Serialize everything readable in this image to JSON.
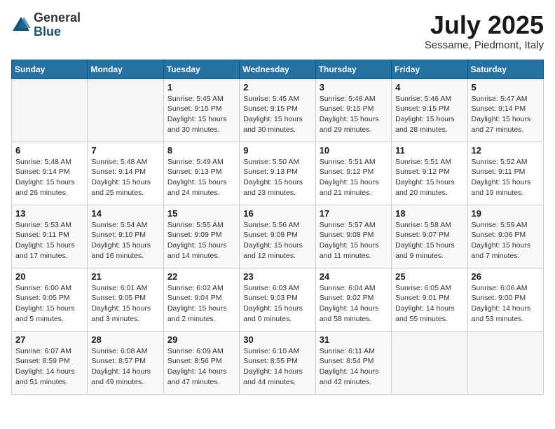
{
  "logo": {
    "general": "General",
    "blue": "Blue"
  },
  "title": "July 2025",
  "subtitle": "Sessame, Piedmont, Italy",
  "days_header": [
    "Sunday",
    "Monday",
    "Tuesday",
    "Wednesday",
    "Thursday",
    "Friday",
    "Saturday"
  ],
  "weeks": [
    [
      {
        "day": "",
        "detail": ""
      },
      {
        "day": "",
        "detail": ""
      },
      {
        "day": "1",
        "detail": "Sunrise: 5:45 AM\nSunset: 9:15 PM\nDaylight: 15 hours\nand 30 minutes."
      },
      {
        "day": "2",
        "detail": "Sunrise: 5:45 AM\nSunset: 9:15 PM\nDaylight: 15 hours\nand 30 minutes."
      },
      {
        "day": "3",
        "detail": "Sunrise: 5:46 AM\nSunset: 9:15 PM\nDaylight: 15 hours\nand 29 minutes."
      },
      {
        "day": "4",
        "detail": "Sunrise: 5:46 AM\nSunset: 9:15 PM\nDaylight: 15 hours\nand 28 minutes."
      },
      {
        "day": "5",
        "detail": "Sunrise: 5:47 AM\nSunset: 9:14 PM\nDaylight: 15 hours\nand 27 minutes."
      }
    ],
    [
      {
        "day": "6",
        "detail": "Sunrise: 5:48 AM\nSunset: 9:14 PM\nDaylight: 15 hours\nand 26 minutes."
      },
      {
        "day": "7",
        "detail": "Sunrise: 5:48 AM\nSunset: 9:14 PM\nDaylight: 15 hours\nand 25 minutes."
      },
      {
        "day": "8",
        "detail": "Sunrise: 5:49 AM\nSunset: 9:13 PM\nDaylight: 15 hours\nand 24 minutes."
      },
      {
        "day": "9",
        "detail": "Sunrise: 5:50 AM\nSunset: 9:13 PM\nDaylight: 15 hours\nand 23 minutes."
      },
      {
        "day": "10",
        "detail": "Sunrise: 5:51 AM\nSunset: 9:12 PM\nDaylight: 15 hours\nand 21 minutes."
      },
      {
        "day": "11",
        "detail": "Sunrise: 5:51 AM\nSunset: 9:12 PM\nDaylight: 15 hours\nand 20 minutes."
      },
      {
        "day": "12",
        "detail": "Sunrise: 5:52 AM\nSunset: 9:11 PM\nDaylight: 15 hours\nand 19 minutes."
      }
    ],
    [
      {
        "day": "13",
        "detail": "Sunrise: 5:53 AM\nSunset: 9:11 PM\nDaylight: 15 hours\nand 17 minutes."
      },
      {
        "day": "14",
        "detail": "Sunrise: 5:54 AM\nSunset: 9:10 PM\nDaylight: 15 hours\nand 16 minutes."
      },
      {
        "day": "15",
        "detail": "Sunrise: 5:55 AM\nSunset: 9:09 PM\nDaylight: 15 hours\nand 14 minutes."
      },
      {
        "day": "16",
        "detail": "Sunrise: 5:56 AM\nSunset: 9:09 PM\nDaylight: 15 hours\nand 12 minutes."
      },
      {
        "day": "17",
        "detail": "Sunrise: 5:57 AM\nSunset: 9:08 PM\nDaylight: 15 hours\nand 11 minutes."
      },
      {
        "day": "18",
        "detail": "Sunrise: 5:58 AM\nSunset: 9:07 PM\nDaylight: 15 hours\nand 9 minutes."
      },
      {
        "day": "19",
        "detail": "Sunrise: 5:59 AM\nSunset: 9:06 PM\nDaylight: 15 hours\nand 7 minutes."
      }
    ],
    [
      {
        "day": "20",
        "detail": "Sunrise: 6:00 AM\nSunset: 9:05 PM\nDaylight: 15 hours\nand 5 minutes."
      },
      {
        "day": "21",
        "detail": "Sunrise: 6:01 AM\nSunset: 9:05 PM\nDaylight: 15 hours\nand 3 minutes."
      },
      {
        "day": "22",
        "detail": "Sunrise: 6:02 AM\nSunset: 9:04 PM\nDaylight: 15 hours\nand 2 minutes."
      },
      {
        "day": "23",
        "detail": "Sunrise: 6:03 AM\nSunset: 9:03 PM\nDaylight: 15 hours\nand 0 minutes."
      },
      {
        "day": "24",
        "detail": "Sunrise: 6:04 AM\nSunset: 9:02 PM\nDaylight: 14 hours\nand 58 minutes."
      },
      {
        "day": "25",
        "detail": "Sunrise: 6:05 AM\nSunset: 9:01 PM\nDaylight: 14 hours\nand 55 minutes."
      },
      {
        "day": "26",
        "detail": "Sunrise: 6:06 AM\nSunset: 9:00 PM\nDaylight: 14 hours\nand 53 minutes."
      }
    ],
    [
      {
        "day": "27",
        "detail": "Sunrise: 6:07 AM\nSunset: 8:59 PM\nDaylight: 14 hours\nand 51 minutes."
      },
      {
        "day": "28",
        "detail": "Sunrise: 6:08 AM\nSunset: 8:57 PM\nDaylight: 14 hours\nand 49 minutes."
      },
      {
        "day": "29",
        "detail": "Sunrise: 6:09 AM\nSunset: 8:56 PM\nDaylight: 14 hours\nand 47 minutes."
      },
      {
        "day": "30",
        "detail": "Sunrise: 6:10 AM\nSunset: 8:55 PM\nDaylight: 14 hours\nand 44 minutes."
      },
      {
        "day": "31",
        "detail": "Sunrise: 6:11 AM\nSunset: 8:54 PM\nDaylight: 14 hours\nand 42 minutes."
      },
      {
        "day": "",
        "detail": ""
      },
      {
        "day": "",
        "detail": ""
      }
    ]
  ]
}
